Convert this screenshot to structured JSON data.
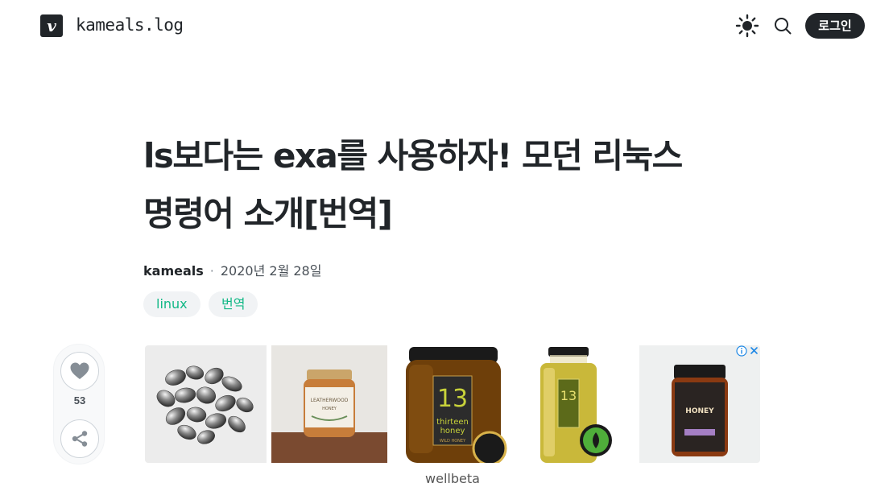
{
  "header": {
    "logo_letter": "v",
    "blog_name": "kameals.log",
    "login_label": "로그인"
  },
  "post": {
    "title_line1": "ls보다는 exa를 사용하자! 모던 리눅스",
    "title_line2": "명령어 소개[번역]",
    "author": "kameals",
    "separator": "·",
    "date": "2020년 2월 28일",
    "tags": [
      "linux",
      "번역"
    ],
    "like_count": "53"
  },
  "ad": {
    "brand": "wellbeta",
    "items": [
      "hematite-stones",
      "leatherwood-honey-jar",
      "thirteen-honey-dark-jar",
      "thirteen-honey-light-jar",
      "honey-jar-dark-lid"
    ],
    "label_13": "13",
    "label_thirteen": "thirteen",
    "label_honey": "honey",
    "label_wild": "WILD HONEY",
    "label_leatherwood": "LEATHERWOOD",
    "label_honey_caps": "HONEY"
  },
  "colors": {
    "accent": "#12b886",
    "dark": "#212529",
    "tag_bg": "#f1f3f5"
  },
  "icons": {
    "theme": "sun-icon",
    "search": "search-icon",
    "like": "heart-icon",
    "share": "share-icon",
    "ad_info": "info-icon",
    "ad_close": "close-icon"
  }
}
